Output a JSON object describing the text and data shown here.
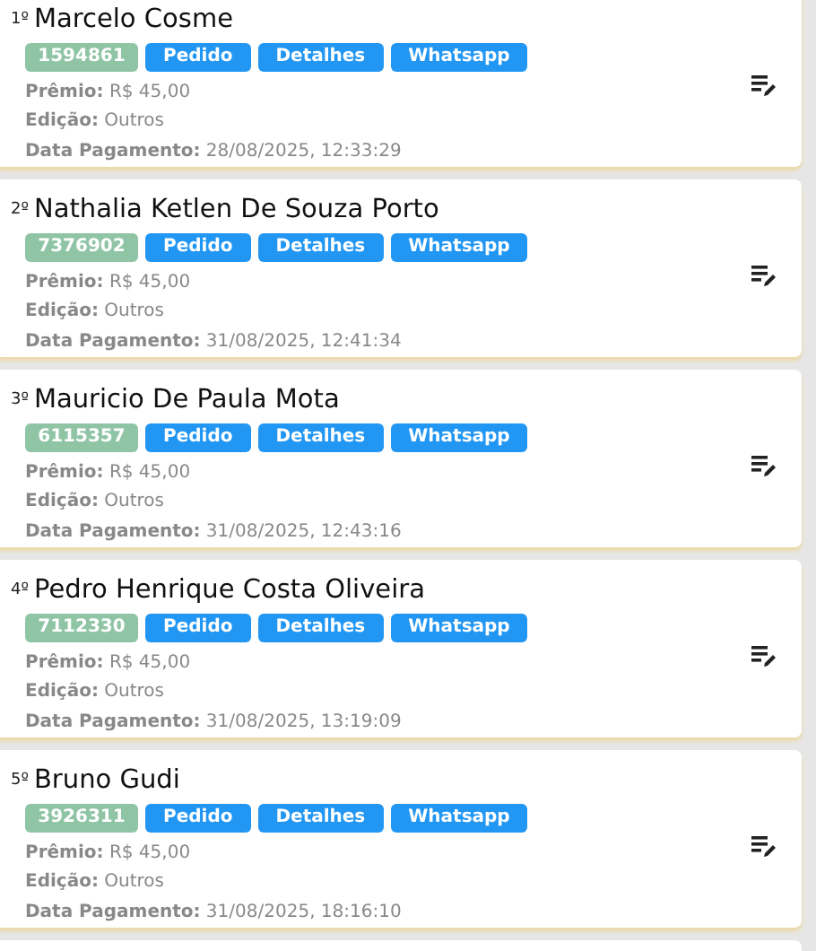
{
  "entries": [
    {
      "rank": "1º",
      "name": "Marcelo Cosme",
      "code": "1594861",
      "buttons": [
        "Pedido",
        "Detalhes",
        "Whatsapp"
      ],
      "details": [
        "**Prêmio:** R$ 45,00",
        "**Edição:** Outros",
        "**Data Pagamento:** 28/08/2025, 12:33:29"
      ]
    },
    {
      "rank": "2º",
      "name": "Nathalia Ketlen De Souza Porto",
      "code": "7376902",
      "buttons": [
        "Pedido",
        "Detalhes",
        "Whatsapp"
      ],
      "details": [
        "**Prêmio:** R$ 45,00",
        "**Edição:** Outros",
        "**Data Pagamento:** 31/08/2025, 12:41:34"
      ]
    },
    {
      "rank": "3º",
      "name": "Mauricio De Paula Mota",
      "code": "6115357",
      "buttons": [
        "Pedido",
        "Detalhes",
        "Whatsapp"
      ],
      "details": [
        "**Prêmio:** R$ 45,00",
        "**Edição:** Outros",
        "**Data Pagamento:** 31/08/2025, 12:43:16"
      ]
    },
    {
      "rank": "4º",
      "name": "Pedro Henrique Costa Oliveira",
      "code": "7112330",
      "buttons": [
        "Pedido",
        "Detalhes",
        "Whatsapp"
      ],
      "details": [
        "**Prêmio:** R$ 45,00",
        "**Edição:** Outros",
        "**Data Pagamento:** 31/08/2025, 13:19:09"
      ]
    },
    {
      "rank": "5º",
      "name": "Bruno Gudi",
      "code": "3926311",
      "buttons": [
        "Pedido",
        "Detalhes",
        "Whatsapp"
      ],
      "details": [
        "**Prêmio:** R$ 45,00",
        "**Edição:** Outros",
        "**Data Pagamento:** 31/08/2025, 18:16:10"
      ]
    }
  ]
}
